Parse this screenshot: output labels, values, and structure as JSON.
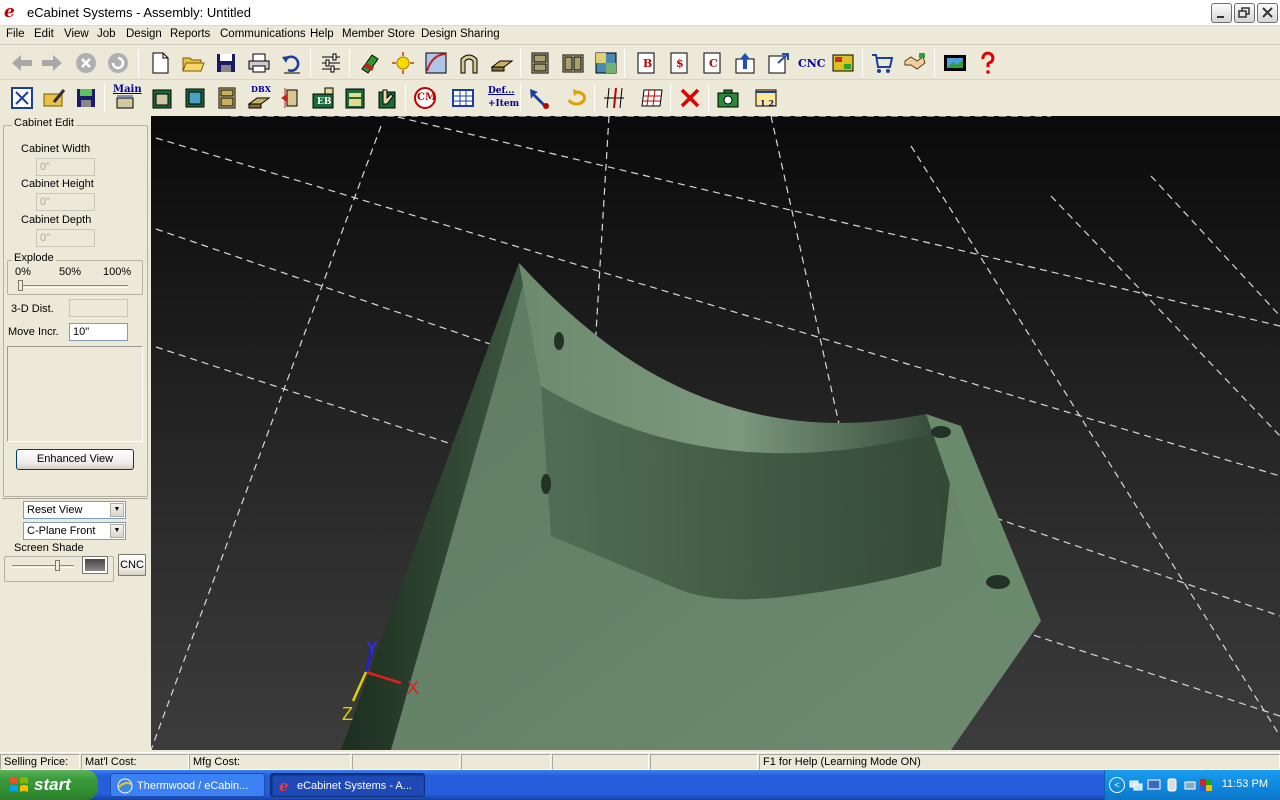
{
  "window": {
    "title": "eCabinet Systems - Assembly: Untitled",
    "app_icon_glyph": "e"
  },
  "menu": [
    "File",
    "Edit",
    "View",
    "Job",
    "Design",
    "Reports",
    "Communications",
    "Help",
    "Member Store",
    "Design Sharing"
  ],
  "toolbar1": {
    "cnc_label": "CNC",
    "b_label": "B",
    "dollar_label": "$",
    "c_label": "C"
  },
  "toolbar2": {
    "main_label": "Main",
    "dbx_label": "DBX",
    "eb_label": "EB",
    "cm_label": "CM",
    "def_label_1": "Def...",
    "def_label_2": "+Item",
    "ruler_label": "1 2"
  },
  "left_panel": {
    "cabinet_edit": {
      "title": "Cabinet Edit",
      "width_label": "Cabinet Width",
      "width_value": "0\"",
      "height_label": "Cabinet Height",
      "height_value": "0\"",
      "depth_label": "Cabinet Depth",
      "depth_value": "0\""
    },
    "explode": {
      "title": "Explode",
      "tick_0": "0%",
      "tick_50": "50%",
      "tick_100": "100%",
      "level": 0
    },
    "dist_label": "3-D Dist.",
    "dist_value": "",
    "move_incr_label": "Move Incr.",
    "move_incr_value": "10\"",
    "enhanced_view_label": "Enhanced View",
    "view_select": "Reset View",
    "plane_select": "C-Plane Front",
    "screen_shade": {
      "title": "Screen Shade",
      "level": 0.75
    },
    "cnc_button": "CNC"
  },
  "viewport": {
    "axis_x": "X",
    "axis_y": "Y",
    "axis_z": "Z",
    "part_color": "#5e7a62"
  },
  "status": {
    "selling_price": "Selling Price:",
    "matl_cost": "Mat'l Cost:",
    "mfg_cost": "Mfg Cost:",
    "help": "F1 for Help (Learning Mode ON)"
  },
  "taskbar": {
    "start_label": "start",
    "items": [
      {
        "label": "Thermwood / eCabin..."
      },
      {
        "label": "eCabinet Systems - A..."
      }
    ],
    "clock": "11:53 PM"
  }
}
